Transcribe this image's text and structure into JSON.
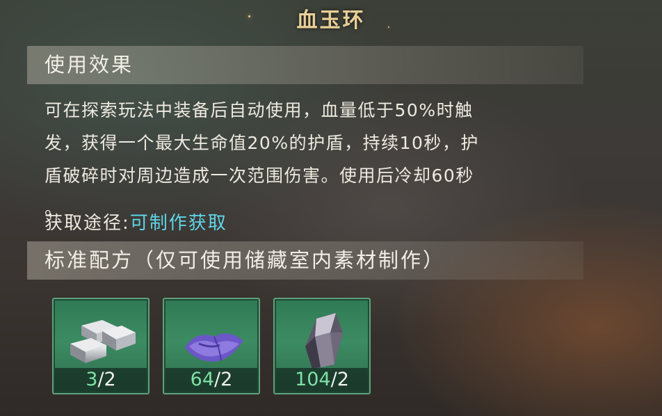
{
  "title": "血玉环",
  "effect": {
    "header": "使用效果",
    "lines": [
      "可在探索玩法中装备后自动使用，血量低于50%时触",
      "发，获得一个最大生命值20%的护盾，持续10秒，护",
      "盾破碎时对周边造成一次范围伤害。使用后冷却60秒",
      "。"
    ]
  },
  "source": {
    "label": "获取途径:",
    "value": "可制作获取"
  },
  "recipe": {
    "header": "标准配方（仅可使用储藏室内素材制作）",
    "materials": [
      {
        "icon": "silver-ingot-icon",
        "have": "3",
        "need": "/2"
      },
      {
        "icon": "purple-cloth-icon",
        "have": "64",
        "need": "/2"
      },
      {
        "icon": "dark-crystal-icon",
        "have": "104",
        "need": "/2"
      }
    ]
  }
}
